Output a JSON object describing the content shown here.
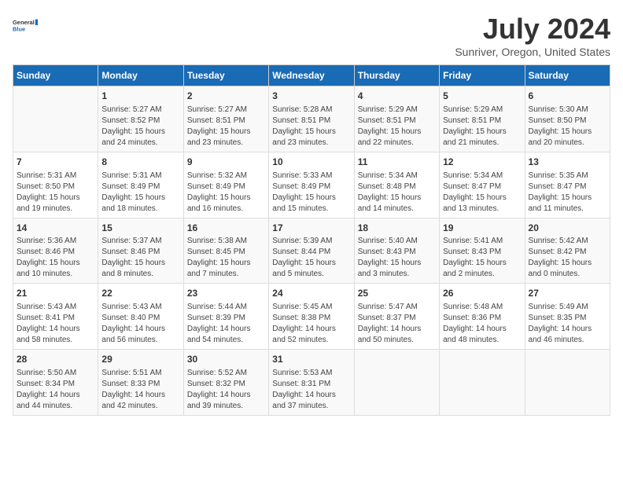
{
  "logo": {
    "general": "General",
    "blue": "Blue"
  },
  "title": "July 2024",
  "subtitle": "Sunriver, Oregon, United States",
  "columns": [
    "Sunday",
    "Monday",
    "Tuesday",
    "Wednesday",
    "Thursday",
    "Friday",
    "Saturday"
  ],
  "weeks": [
    [
      {
        "day": "",
        "info": ""
      },
      {
        "day": "1",
        "info": "Sunrise: 5:27 AM\nSunset: 8:52 PM\nDaylight: 15 hours\nand 24 minutes."
      },
      {
        "day": "2",
        "info": "Sunrise: 5:27 AM\nSunset: 8:51 PM\nDaylight: 15 hours\nand 23 minutes."
      },
      {
        "day": "3",
        "info": "Sunrise: 5:28 AM\nSunset: 8:51 PM\nDaylight: 15 hours\nand 23 minutes."
      },
      {
        "day": "4",
        "info": "Sunrise: 5:29 AM\nSunset: 8:51 PM\nDaylight: 15 hours\nand 22 minutes."
      },
      {
        "day": "5",
        "info": "Sunrise: 5:29 AM\nSunset: 8:51 PM\nDaylight: 15 hours\nand 21 minutes."
      },
      {
        "day": "6",
        "info": "Sunrise: 5:30 AM\nSunset: 8:50 PM\nDaylight: 15 hours\nand 20 minutes."
      }
    ],
    [
      {
        "day": "7",
        "info": "Sunrise: 5:31 AM\nSunset: 8:50 PM\nDaylight: 15 hours\nand 19 minutes."
      },
      {
        "day": "8",
        "info": "Sunrise: 5:31 AM\nSunset: 8:49 PM\nDaylight: 15 hours\nand 18 minutes."
      },
      {
        "day": "9",
        "info": "Sunrise: 5:32 AM\nSunset: 8:49 PM\nDaylight: 15 hours\nand 16 minutes."
      },
      {
        "day": "10",
        "info": "Sunrise: 5:33 AM\nSunset: 8:49 PM\nDaylight: 15 hours\nand 15 minutes."
      },
      {
        "day": "11",
        "info": "Sunrise: 5:34 AM\nSunset: 8:48 PM\nDaylight: 15 hours\nand 14 minutes."
      },
      {
        "day": "12",
        "info": "Sunrise: 5:34 AM\nSunset: 8:47 PM\nDaylight: 15 hours\nand 13 minutes."
      },
      {
        "day": "13",
        "info": "Sunrise: 5:35 AM\nSunset: 8:47 PM\nDaylight: 15 hours\nand 11 minutes."
      }
    ],
    [
      {
        "day": "14",
        "info": "Sunrise: 5:36 AM\nSunset: 8:46 PM\nDaylight: 15 hours\nand 10 minutes."
      },
      {
        "day": "15",
        "info": "Sunrise: 5:37 AM\nSunset: 8:46 PM\nDaylight: 15 hours\nand 8 minutes."
      },
      {
        "day": "16",
        "info": "Sunrise: 5:38 AM\nSunset: 8:45 PM\nDaylight: 15 hours\nand 7 minutes."
      },
      {
        "day": "17",
        "info": "Sunrise: 5:39 AM\nSunset: 8:44 PM\nDaylight: 15 hours\nand 5 minutes."
      },
      {
        "day": "18",
        "info": "Sunrise: 5:40 AM\nSunset: 8:43 PM\nDaylight: 15 hours\nand 3 minutes."
      },
      {
        "day": "19",
        "info": "Sunrise: 5:41 AM\nSunset: 8:43 PM\nDaylight: 15 hours\nand 2 minutes."
      },
      {
        "day": "20",
        "info": "Sunrise: 5:42 AM\nSunset: 8:42 PM\nDaylight: 15 hours\nand 0 minutes."
      }
    ],
    [
      {
        "day": "21",
        "info": "Sunrise: 5:43 AM\nSunset: 8:41 PM\nDaylight: 14 hours\nand 58 minutes."
      },
      {
        "day": "22",
        "info": "Sunrise: 5:43 AM\nSunset: 8:40 PM\nDaylight: 14 hours\nand 56 minutes."
      },
      {
        "day": "23",
        "info": "Sunrise: 5:44 AM\nSunset: 8:39 PM\nDaylight: 14 hours\nand 54 minutes."
      },
      {
        "day": "24",
        "info": "Sunrise: 5:45 AM\nSunset: 8:38 PM\nDaylight: 14 hours\nand 52 minutes."
      },
      {
        "day": "25",
        "info": "Sunrise: 5:47 AM\nSunset: 8:37 PM\nDaylight: 14 hours\nand 50 minutes."
      },
      {
        "day": "26",
        "info": "Sunrise: 5:48 AM\nSunset: 8:36 PM\nDaylight: 14 hours\nand 48 minutes."
      },
      {
        "day": "27",
        "info": "Sunrise: 5:49 AM\nSunset: 8:35 PM\nDaylight: 14 hours\nand 46 minutes."
      }
    ],
    [
      {
        "day": "28",
        "info": "Sunrise: 5:50 AM\nSunset: 8:34 PM\nDaylight: 14 hours\nand 44 minutes."
      },
      {
        "day": "29",
        "info": "Sunrise: 5:51 AM\nSunset: 8:33 PM\nDaylight: 14 hours\nand 42 minutes."
      },
      {
        "day": "30",
        "info": "Sunrise: 5:52 AM\nSunset: 8:32 PM\nDaylight: 14 hours\nand 39 minutes."
      },
      {
        "day": "31",
        "info": "Sunrise: 5:53 AM\nSunset: 8:31 PM\nDaylight: 14 hours\nand 37 minutes."
      },
      {
        "day": "",
        "info": ""
      },
      {
        "day": "",
        "info": ""
      },
      {
        "day": "",
        "info": ""
      }
    ]
  ]
}
